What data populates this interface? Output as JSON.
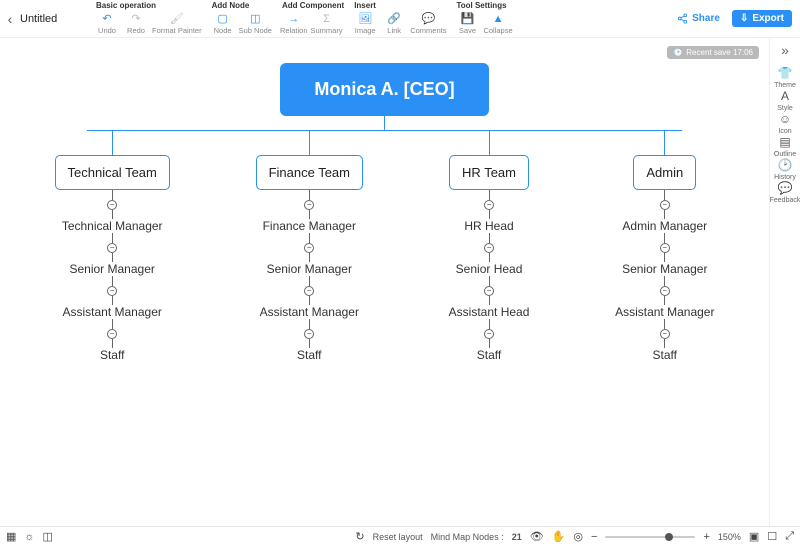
{
  "title": "Untitled",
  "recent_save": "Recent save 17:06",
  "toolbar": {
    "groups": [
      {
        "title": "Basic operation",
        "items": [
          "Undo",
          "Redo",
          "Format Painter"
        ]
      },
      {
        "title": "Add Node",
        "items": [
          "Node",
          "Sub Node"
        ]
      },
      {
        "title": "Add Component",
        "items": [
          "Relation",
          "Summary"
        ]
      },
      {
        "title": "Insert",
        "items": [
          "Image",
          "Link",
          "Comments"
        ]
      },
      {
        "title": "Tool Settings",
        "items": [
          "Save",
          "Collapse"
        ]
      }
    ]
  },
  "share": {
    "share": "Share",
    "export": "Export"
  },
  "right_rail": [
    "Theme",
    "Style",
    "Icon",
    "Outline",
    "History",
    "Feedback"
  ],
  "diagram": {
    "root": "Monica A. [CEO]",
    "branches": [
      {
        "team": "Technical Team",
        "nodes": [
          "Technical Manager",
          "Senior Manager",
          "Assistant Manager",
          "Staff"
        ]
      },
      {
        "team": "Finance Team",
        "nodes": [
          "Finance Manager",
          "Senior Manager",
          "Assistant Manager",
          "Staff"
        ]
      },
      {
        "team": "HR Team",
        "nodes": [
          "HR Head",
          "Senior Head",
          "Assistant Head",
          "Staff"
        ]
      },
      {
        "team": "Admin",
        "nodes": [
          "Admin Manager",
          "Senior Manager",
          "Assistant Manager",
          "Staff"
        ]
      }
    ]
  },
  "bottombar": {
    "reset": "Reset layout",
    "nodes_label": "Mind Map Nodes :",
    "nodes_count": "21",
    "zoom": "150%"
  }
}
